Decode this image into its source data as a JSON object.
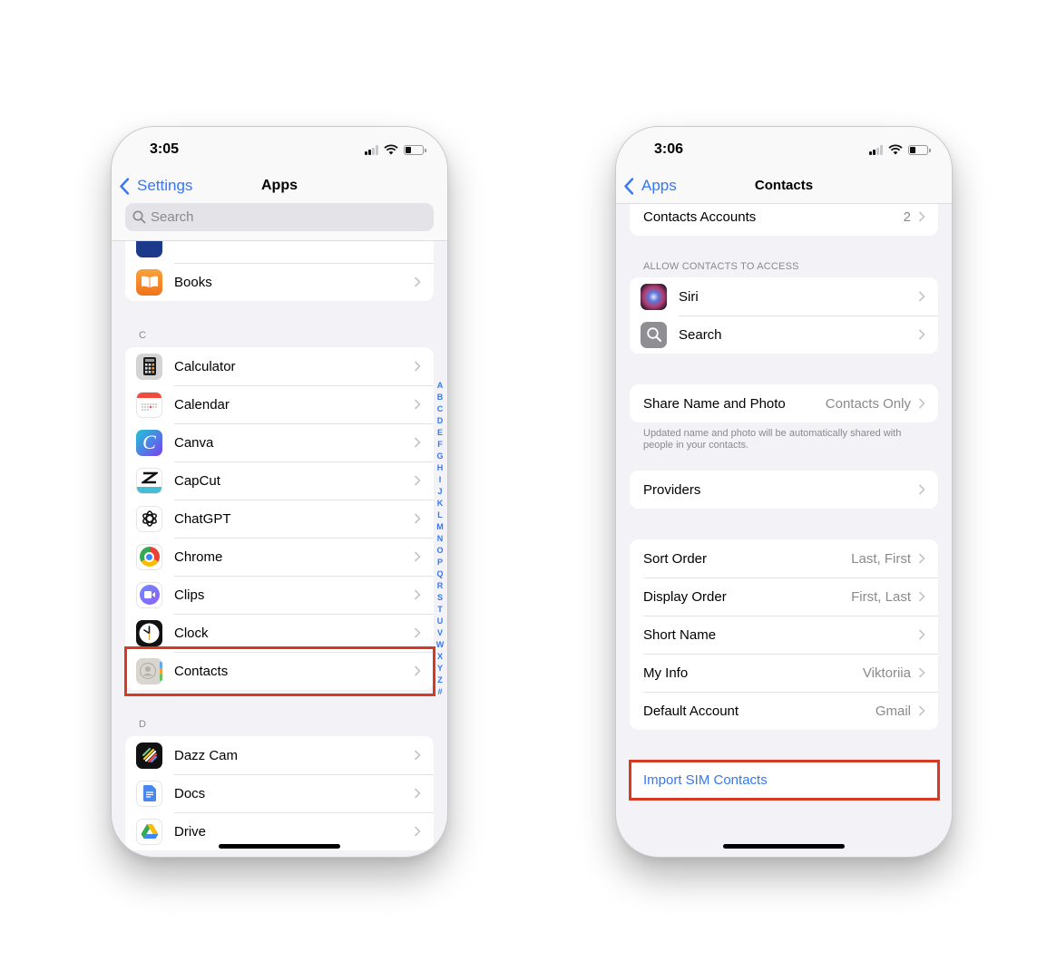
{
  "left_phone": {
    "status": {
      "time": "3:05"
    },
    "nav": {
      "back_label": "Settings",
      "title": "Apps"
    },
    "search": {
      "placeholder": "Search"
    },
    "top_group": [
      {
        "label": "",
        "icon": "partially-hidden-app-icon"
      },
      {
        "label": "Books",
        "icon": "books-icon"
      }
    ],
    "sections": [
      {
        "letter": "C",
        "items": [
          {
            "label": "Calculator",
            "icon": "calculator-icon"
          },
          {
            "label": "Calendar",
            "icon": "calendar-icon"
          },
          {
            "label": "Canva",
            "icon": "canva-icon"
          },
          {
            "label": "CapCut",
            "icon": "capcut-icon"
          },
          {
            "label": "ChatGPT",
            "icon": "chatgpt-icon"
          },
          {
            "label": "Chrome",
            "icon": "chrome-icon"
          },
          {
            "label": "Clips",
            "icon": "clips-icon"
          },
          {
            "label": "Clock",
            "icon": "clock-icon"
          },
          {
            "label": "Contacts",
            "icon": "contacts-icon",
            "highlighted": true
          }
        ]
      },
      {
        "letter": "D",
        "items": [
          {
            "label": "Dazz Cam",
            "icon": "dazz-cam-icon"
          },
          {
            "label": "Docs",
            "icon": "docs-icon"
          },
          {
            "label": "Drive",
            "icon": "drive-icon"
          }
        ]
      }
    ],
    "index_letters": [
      "A",
      "B",
      "C",
      "D",
      "E",
      "F",
      "G",
      "H",
      "I",
      "J",
      "K",
      "L",
      "M",
      "N",
      "O",
      "P",
      "Q",
      "R",
      "S",
      "T",
      "U",
      "V",
      "W",
      "X",
      "Y",
      "Z",
      "#"
    ]
  },
  "right_phone": {
    "status": {
      "time": "3:06"
    },
    "nav": {
      "back_label": "Apps",
      "title": "Contacts"
    },
    "contacts_accounts": {
      "label": "Contacts Accounts",
      "value": "2"
    },
    "allow_access": {
      "caption": "ALLOW CONTACTS TO ACCESS",
      "items": [
        {
          "label": "Siri",
          "icon": "siri-icon"
        },
        {
          "label": "Search",
          "icon": "search-app-icon"
        }
      ]
    },
    "share_name": {
      "label": "Share Name and Photo",
      "value": "Contacts Only",
      "footnote": "Updated name and photo will be automatically shared with people in your contacts."
    },
    "providers": {
      "label": "Providers"
    },
    "settings": [
      {
        "label": "Sort Order",
        "value": "Last, First"
      },
      {
        "label": "Display Order",
        "value": "First, Last"
      },
      {
        "label": "Short Name",
        "value": ""
      },
      {
        "label": "My Info",
        "value": "Viktoriia"
      },
      {
        "label": "Default Account",
        "value": "Gmail"
      }
    ],
    "import_sim": {
      "label": "Import SIM Contacts",
      "highlighted": true
    }
  },
  "colors": {
    "accent": "#3478f6",
    "highlight_border": "#d63a22",
    "grouped_background": "#f2f2f7",
    "secondary_text": "#8a8a8e"
  }
}
